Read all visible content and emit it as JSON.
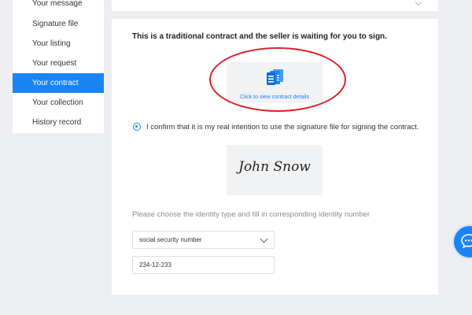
{
  "sidebar": {
    "items": [
      {
        "label": "Your message",
        "active": false
      },
      {
        "label": "Signature file",
        "active": false
      },
      {
        "label": "Your listing",
        "active": false
      },
      {
        "label": "Your request",
        "active": false
      },
      {
        "label": "Your contract",
        "active": true
      },
      {
        "label": "Your collection",
        "active": false
      },
      {
        "label": "History record",
        "active": false
      }
    ]
  },
  "contract": {
    "heading": "This is a traditional contract and the seller is waiting for you to sign.",
    "view_details_label": "Click to view contract details",
    "document_icon": "document-stack-icon",
    "confirm_checked": true,
    "confirm_text": "I confirm that it is my real intention to use the signature file for signing the contract.",
    "signature_name": "John Snow",
    "id_prompt": "Please choose the identity type and fill in corresponding identity number",
    "id_type": "social security number",
    "id_number": "234-12-233"
  },
  "chat": {
    "icon": "chat-bubble-icon"
  },
  "colors": {
    "accent": "#1a84f5",
    "highlight_ellipse": "#d6232a",
    "background": "#eceef1"
  }
}
